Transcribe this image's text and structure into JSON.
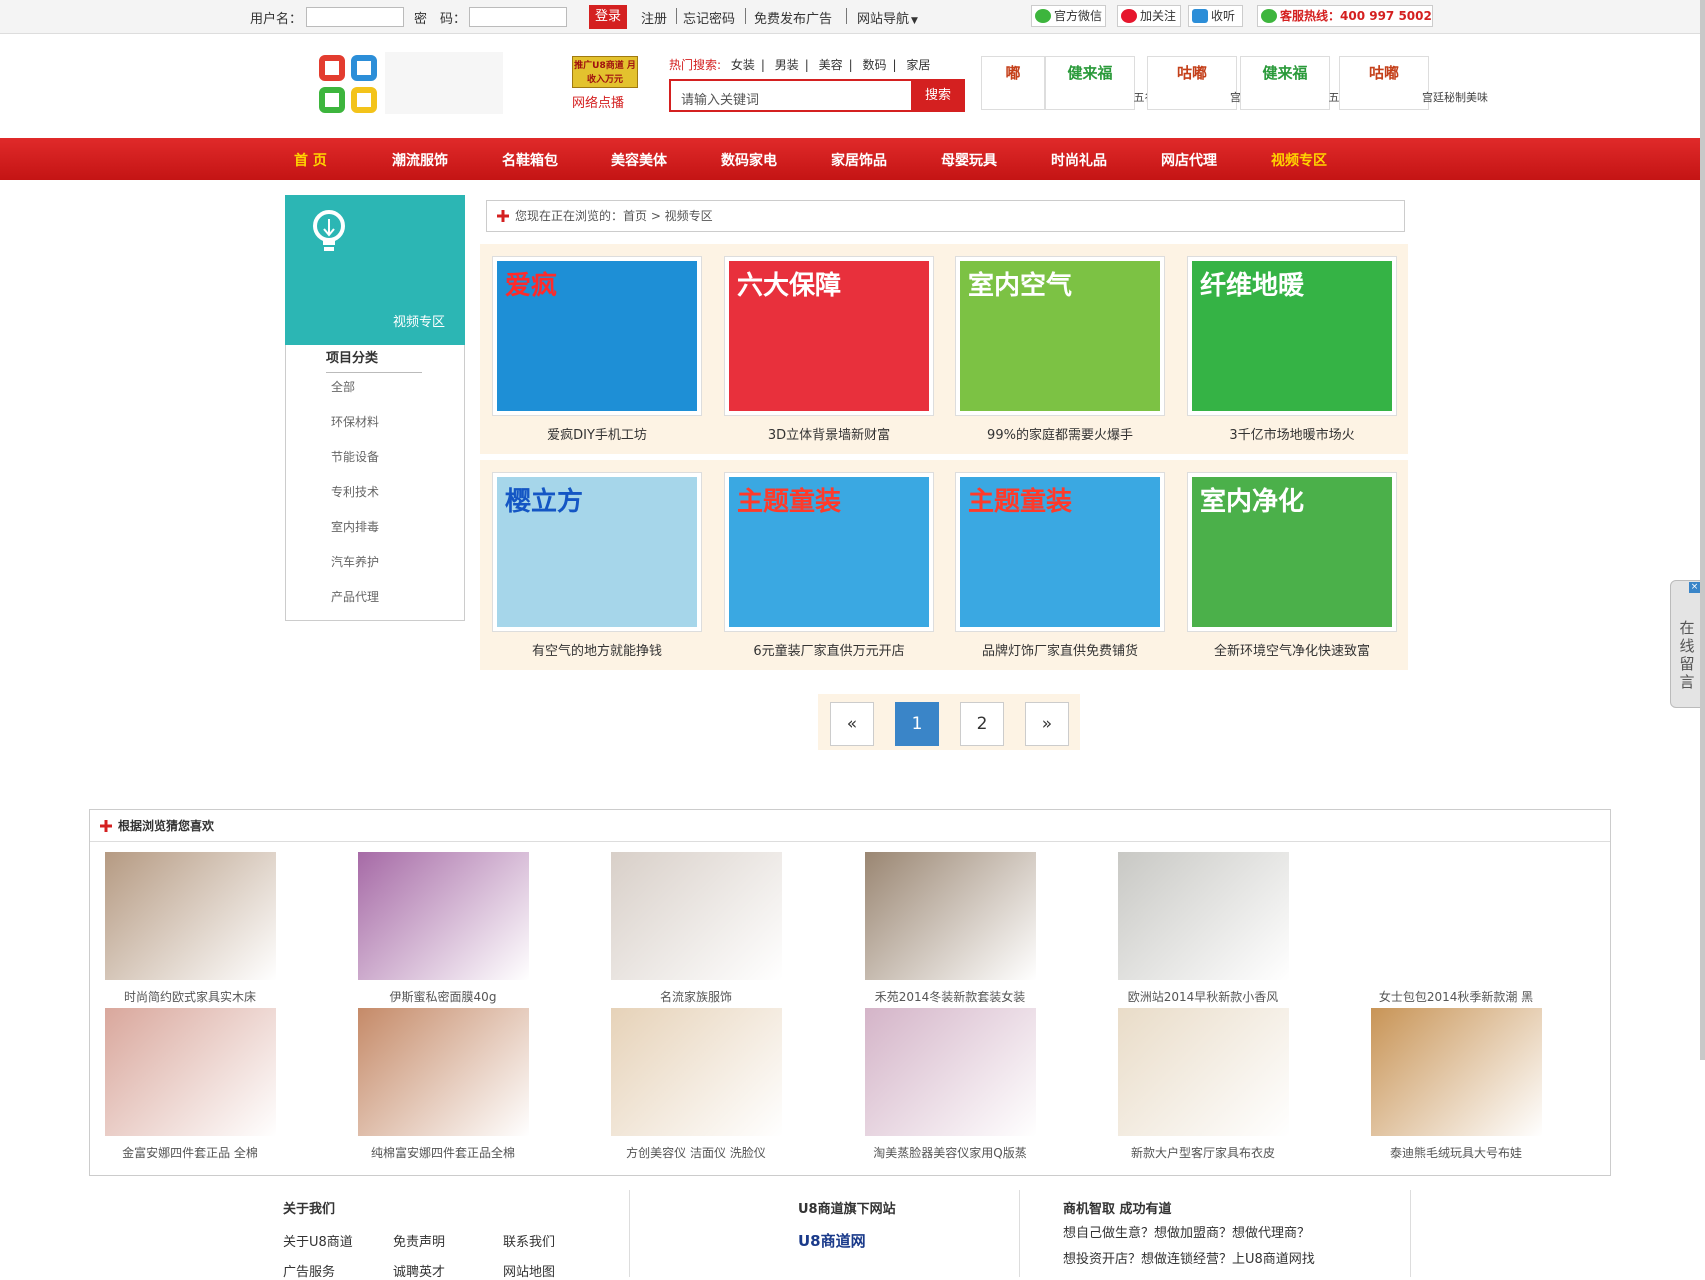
{
  "topbar": {
    "username_label": "用户名：",
    "password_label": "密　码：",
    "login": "登录",
    "register": "注册",
    "forgot": "忘记密码",
    "free_ad": "免费发布广告",
    "site_nav": "网站导航",
    "wechat": "官方微信",
    "weibo": "加关注",
    "listen": "收听",
    "hotline": "客服热线：400 997 5002"
  },
  "header": {
    "promo_box": "推广U8商道 月收入万元",
    "promo_sub": "网络点播",
    "hot_label": "热门搜索:",
    "hot_items": [
      "女装",
      "男装",
      "美容",
      "数码",
      "家居"
    ],
    "search_placeholder": "请输入关键词",
    "search_button": "搜索",
    "ads": [
      {
        "brand": "嘟",
        "caption": "秘制美味"
      },
      {
        "brand": "健来福",
        "caption": "五谷食疗品"
      },
      {
        "brand": "咕嘟",
        "caption": "宫廷秘制美味"
      },
      {
        "brand": "健来福",
        "caption": "五谷食疗品"
      },
      {
        "brand": "咕嘟",
        "caption": "宫廷秘制美味"
      }
    ]
  },
  "nav": [
    "首 页",
    "潮流服饰",
    "名鞋箱包",
    "美容美体",
    "数码家电",
    "家居饰品",
    "母婴玩具",
    "时尚礼品",
    "网店代理",
    "视频专区"
  ],
  "sidebar": {
    "title": "视频专区",
    "section": "项目分类",
    "items": [
      "全部",
      "环保材料",
      "节能设备",
      "专利技术",
      "室内排毒",
      "汽车养护",
      "产品代理"
    ]
  },
  "breadcrumb": "您现在正在浏览的：首页 > 视频专区",
  "videos": [
    {
      "caption": "爱疯DIY手机工坊",
      "text": "爱疯",
      "bg": "#1e8fd6",
      "fg": "#ff2a2a"
    },
    {
      "caption": "3D立体背景墙新财富",
      "text": "六大保障",
      "bg": "#e8303c",
      "fg": "#ffffff"
    },
    {
      "caption": "99%的家庭都需要火爆手",
      "text": "室内空气",
      "bg": "#7cc244",
      "fg": "#ffffff"
    },
    {
      "caption": "3千亿市场地暖市场火",
      "text": "纤维地暖",
      "bg": "#35b345",
      "fg": "#ffffff"
    },
    {
      "caption": "有空气的地方就能挣钱",
      "text": "樱立方",
      "bg": "#a6d6ea",
      "fg": "#1456c4"
    },
    {
      "caption": "6元童装厂家直供万元开店",
      "text": "主题童装",
      "bg": "#3aa8e2",
      "fg": "#ff3a2a"
    },
    {
      "caption": "品牌灯饰厂家直供免费铺货",
      "text": "主题童装",
      "bg": "#3aa8e2",
      "fg": "#ff3a2a"
    },
    {
      "caption": "全新环境空气净化快速致富",
      "text": "室内净化",
      "bg": "#4bb04a",
      "fg": "#ffffff"
    }
  ],
  "pagination": [
    "«",
    "1",
    "2",
    "»"
  ],
  "recommend": {
    "title": "根据浏览猜您喜欢",
    "items": [
      {
        "caption": "时尚简约欧式家具实木床",
        "bg": "#b59a82"
      },
      {
        "caption": "伊斯蜜私密面膜40g",
        "bg": "#a66aa6"
      },
      {
        "caption": "名流家族服饰",
        "bg": "#d8cfc8"
      },
      {
        "caption": "禾苑2014冬装新款套装女装",
        "bg": "#9a8672"
      },
      {
        "caption": "欧洲站2014早秋新款小香风",
        "bg": "#c8c8c4"
      },
      {
        "caption": "女士包包2014秋季新款潮 黑",
        "bg": "#ffffff"
      },
      {
        "caption": "金富安娜四件套正品 全棉",
        "bg": "#d9a79c"
      },
      {
        "caption": "纯棉富安娜四件套正品全棉",
        "bg": "#c58a68"
      },
      {
        "caption": "方创美容仪 洁面仪 洗脸仪",
        "bg": "#e6d2b8"
      },
      {
        "caption": "淘美蒸脸器美容仪家用Q版蒸",
        "bg": "#d4b4c8"
      },
      {
        "caption": "新款大户型客厅家具布衣皮",
        "bg": "#e9dcc8"
      },
      {
        "caption": "泰迪熊毛绒玩具大号布娃",
        "bg": "#c89456"
      }
    ]
  },
  "footer": {
    "about_title": "关于我们",
    "about_links": [
      "关于U8商道",
      "免责声明",
      "联系我们",
      "广告服务",
      "诚聘英才",
      "网站地图"
    ],
    "site_title": "U8商道旗下网站",
    "site_logo": "U8商道网",
    "slogan_title": "商机智取 成功有道",
    "slogan_lines": [
      "想自己做生意？想做加盟商？想做代理商？",
      "想投资开店？想做连锁经营？上U8商道网找"
    ]
  },
  "float": {
    "label": "在线留言",
    "close": "×"
  }
}
